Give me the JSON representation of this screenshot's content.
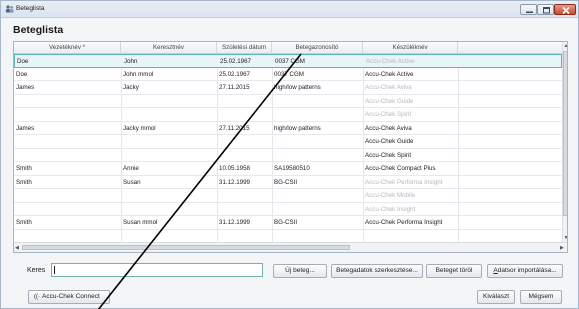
{
  "window": {
    "title": "Beteglista"
  },
  "page": {
    "heading": "Beteglista"
  },
  "table": {
    "columns": [
      "Vezetéknév *",
      "Keresztnév",
      "Születési dátum",
      "Betegazonosító",
      "Készüléknév"
    ],
    "rows": [
      {
        "last": "Doe",
        "first": "John",
        "dob": "25.02.1967",
        "id": "0037 CGM",
        "device": "Accu-Chek Active",
        "device_inactive": true,
        "selected": true
      },
      {
        "last": "Doe",
        "first": "John mmol",
        "dob": "25.02.1967",
        "id": "0037 CGM",
        "device": "Accu-Chek Active",
        "device_inactive": false,
        "selected": false
      },
      {
        "last": "James",
        "first": "Jacky",
        "dob": "27.11.2015",
        "id": "high/low patterns",
        "device": "Accu-Chek Aviva",
        "device_inactive": true,
        "selected": false
      },
      {
        "last": "",
        "first": "",
        "dob": "",
        "id": "",
        "device": "Accu-Chek Guide",
        "device_inactive": true,
        "selected": false
      },
      {
        "last": "",
        "first": "",
        "dob": "",
        "id": "",
        "device": "Accu-Chek Spirit",
        "device_inactive": true,
        "selected": false
      },
      {
        "last": "James",
        "first": "Jacky mmol",
        "dob": "27.11.2015",
        "id": "high/low patterns",
        "device": "Accu-Chek Aviva",
        "device_inactive": false,
        "selected": false
      },
      {
        "last": "",
        "first": "",
        "dob": "",
        "id": "",
        "device": "Accu-Chek Guide",
        "device_inactive": false,
        "selected": false
      },
      {
        "last": "",
        "first": "",
        "dob": "",
        "id": "",
        "device": "Accu-Chek Spirit",
        "device_inactive": false,
        "selected": false
      },
      {
        "last": "Smith",
        "first": "Annie",
        "dob": "10.05.1958",
        "id": "SA19580510",
        "device": "Accu-Chek Compact Plus",
        "device_inactive": false,
        "selected": false
      },
      {
        "last": "Smith",
        "first": "Susan",
        "dob": "31.12.1999",
        "id": "BG-CSII",
        "device": "Accu-Chek Performa Insight",
        "device_inactive": true,
        "selected": false
      },
      {
        "last": "",
        "first": "",
        "dob": "",
        "id": "",
        "device": "Accu-Chek Mobile",
        "device_inactive": true,
        "selected": false
      },
      {
        "last": "",
        "first": "",
        "dob": "",
        "id": "",
        "device": "Accu-Chek Insight",
        "device_inactive": true,
        "selected": false
      },
      {
        "last": "Smith",
        "first": "Susan mmol",
        "dob": "31.12.1999",
        "id": "BG-CSII",
        "device": "Accu-Chek Performa Insight",
        "device_inactive": false,
        "selected": false
      }
    ]
  },
  "search": {
    "label": "Keres",
    "value": "",
    "placeholder": ""
  },
  "actions": {
    "new_patient": "Új beteg...",
    "edit_patient": "Betegadatok szerkesztése...",
    "delete_patient": "Beteget töröl",
    "import_prefix": "",
    "import_underlined": "A",
    "import_rest": "datsor importálása..."
  },
  "footer": {
    "connect_label": "Accu-Chek Connect",
    "select_label": "Kiválaszt",
    "cancel_label": "Mégsem"
  },
  "colors": {
    "selection_border": "#5fb6b9",
    "selection_fill": "#e7f5f6",
    "inactive_text": "#b5b9be"
  },
  "icons": {
    "app": "patients-icon",
    "connect": "wireless-signal-icon"
  }
}
